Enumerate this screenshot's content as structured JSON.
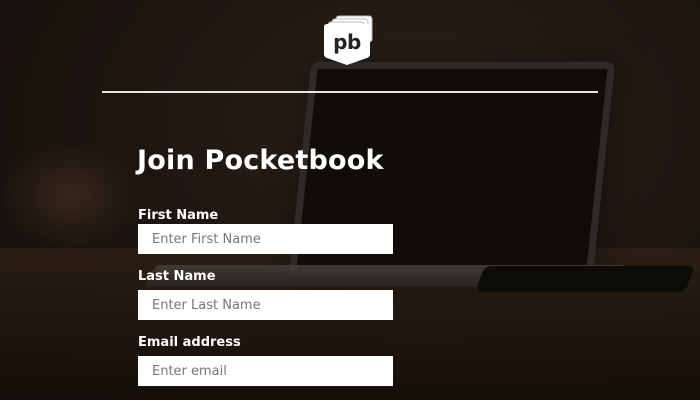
{
  "logo": {
    "text": "pb",
    "icon": "pocketbook-logo-icon"
  },
  "page": {
    "title": "Join Pocketbook"
  },
  "form": {
    "first_name": {
      "label": "First Name",
      "placeholder": "Enter First Name",
      "value": ""
    },
    "last_name": {
      "label": "Last Name",
      "placeholder": "Enter Last Name",
      "value": ""
    },
    "email": {
      "label": "Email address",
      "placeholder": "Enter email",
      "value": ""
    }
  },
  "colors": {
    "text": "#ffffff",
    "divider": "#e8e4e0",
    "input_bg": "#ffffff",
    "background": "#1b1511"
  }
}
